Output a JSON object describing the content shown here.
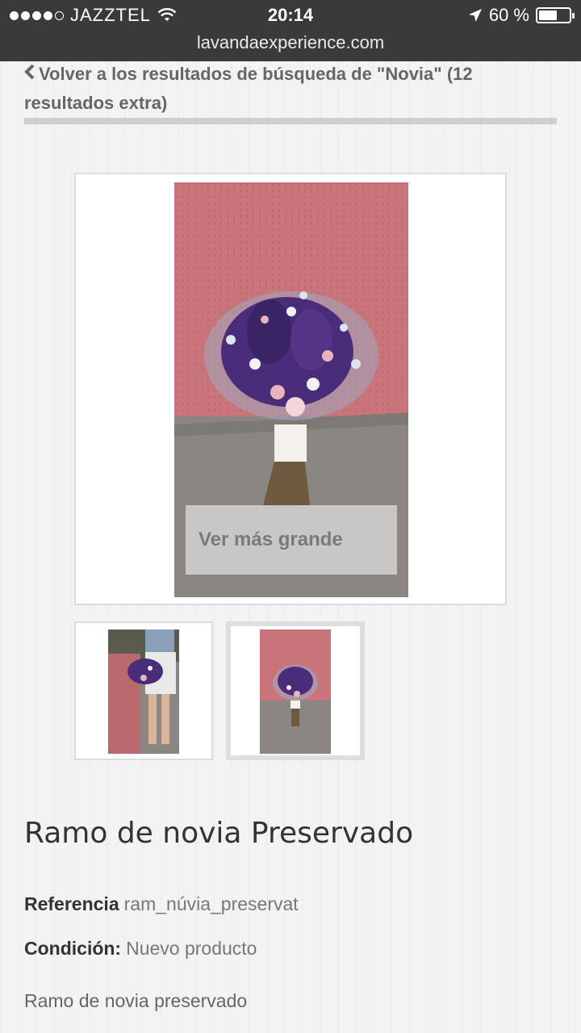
{
  "status": {
    "carrier": "JAZZTEL",
    "time": "20:14",
    "battery_text": "60 %",
    "battery_level": 0.6,
    "url": "lavandaexperience.com"
  },
  "nav": {
    "back_label": "Volver a los resultados de búsqueda de \"Novia\" (12 resultados extra)"
  },
  "gallery": {
    "zoom_label": "Ver más grande"
  },
  "product": {
    "name": "Ramo de novia Preservado",
    "reference_label": "Referencia",
    "reference_value": "ram_núvia_preservat",
    "condition_label": "Condición:",
    "condition_value": "Nuevo producto",
    "description": "Ramo de novia preservado"
  },
  "colors": {
    "wall": "#c8747a",
    "ground": "#8a8782",
    "lavender": "#4a2d7a",
    "flower_white": "#f2f2f2",
    "flower_pink": "#e8b4bc"
  }
}
